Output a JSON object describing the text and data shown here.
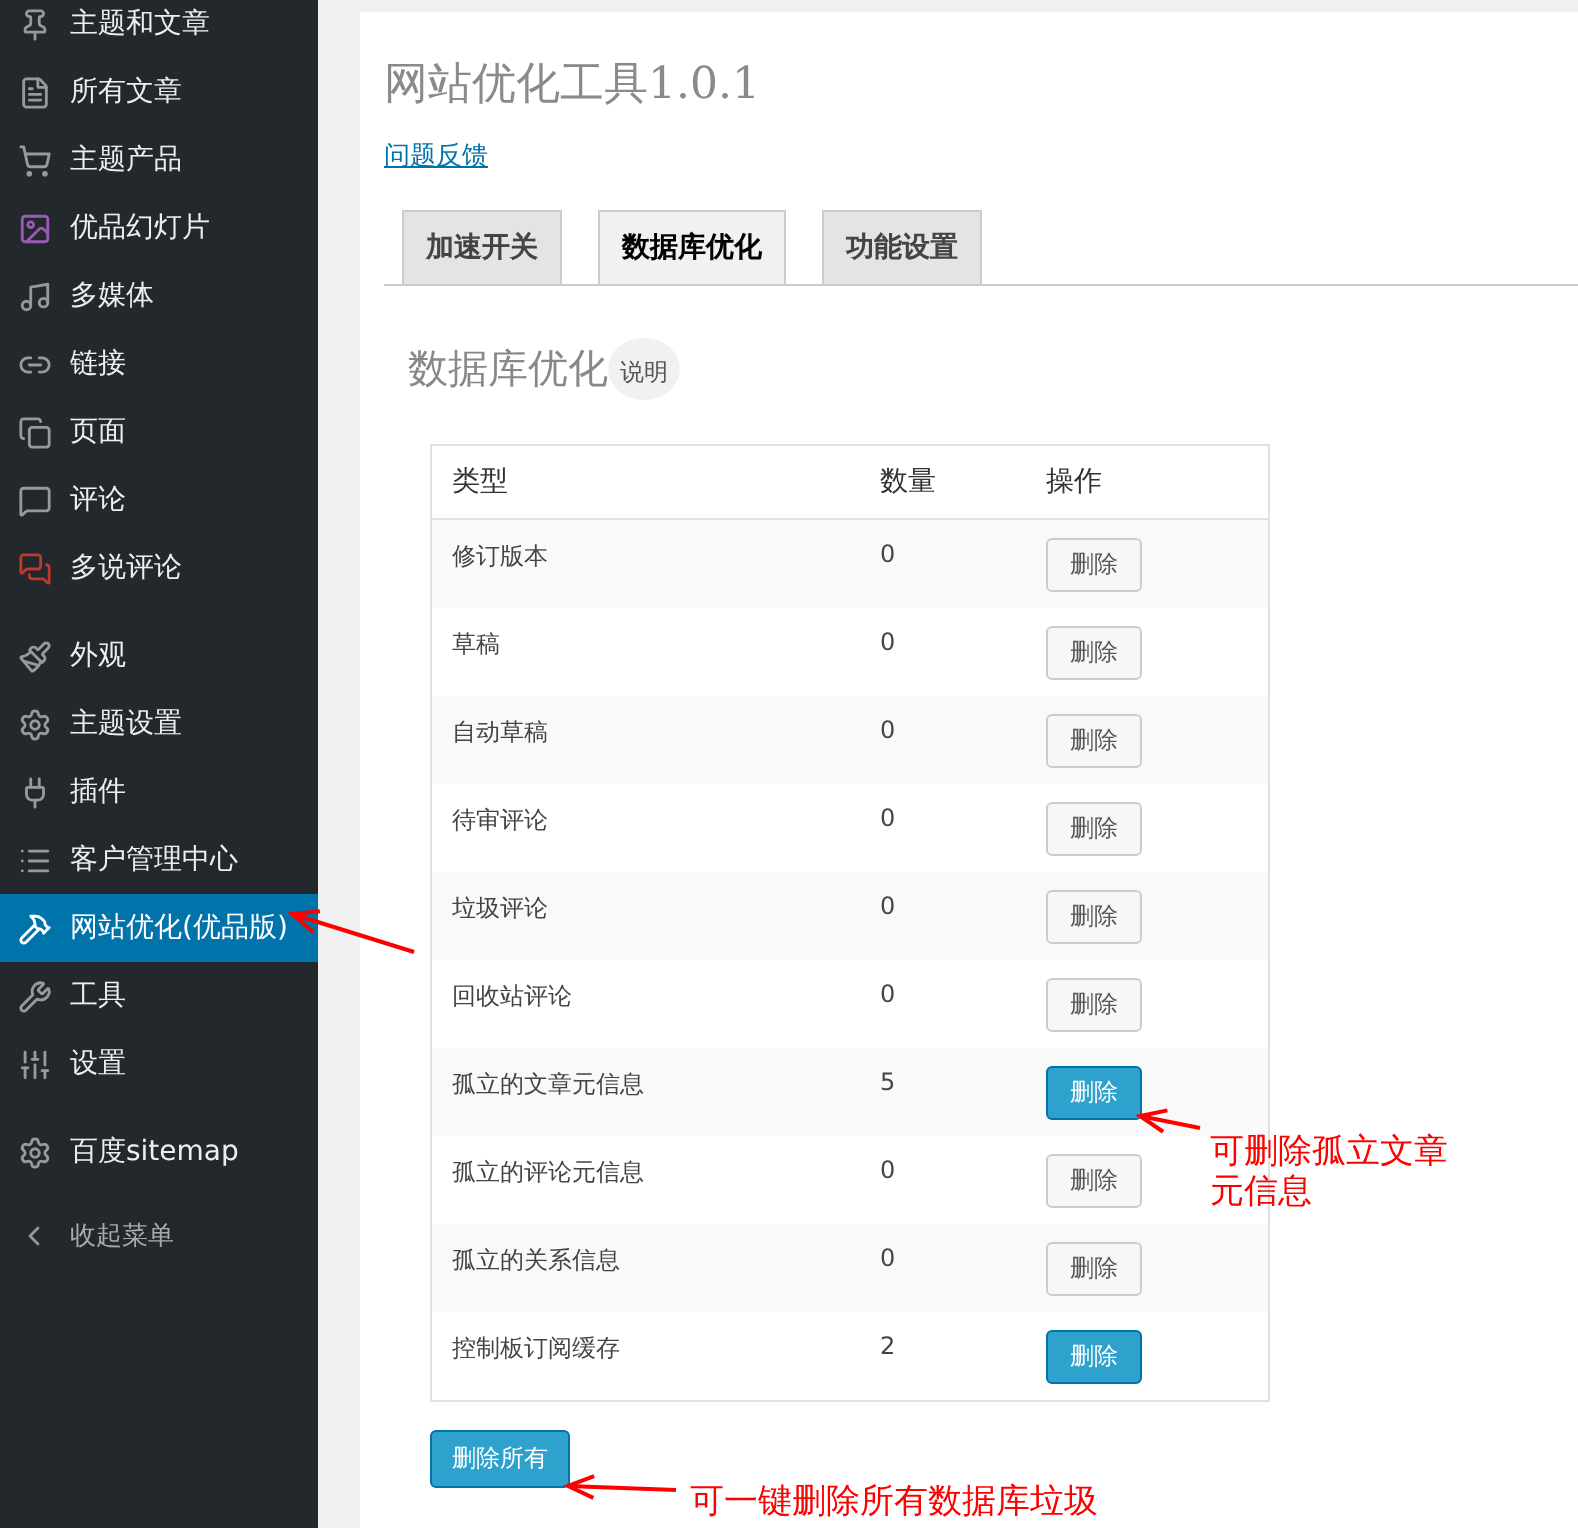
{
  "sidebar": {
    "groups": [
      {
        "items": [
          {
            "label": "主题和文章",
            "selected": false
          },
          {
            "label": "所有文章",
            "selected": false
          },
          {
            "label": "主题产品",
            "selected": false
          },
          {
            "label": "优品幻灯片",
            "selected": false
          },
          {
            "label": "多媒体",
            "selected": false
          },
          {
            "label": "链接",
            "selected": false
          },
          {
            "label": "页面",
            "selected": false
          },
          {
            "label": "评论",
            "selected": false
          },
          {
            "label": "多说评论",
            "selected": false
          }
        ]
      },
      {
        "items": [
          {
            "label": "外观",
            "selected": false
          },
          {
            "label": "主题设置",
            "selected": false
          },
          {
            "label": "插件",
            "selected": false
          },
          {
            "label": "客户管理中心",
            "selected": false
          },
          {
            "label": "网站优化(优品版)",
            "selected": true
          },
          {
            "label": "工具",
            "selected": false
          },
          {
            "label": "设置",
            "selected": false
          }
        ]
      },
      {
        "items": [
          {
            "label": "百度sitemap",
            "selected": false
          }
        ]
      }
    ],
    "collapse": "收起菜单"
  },
  "page": {
    "title": "网站优化工具1.0.1",
    "feedback_link": "问题反馈"
  },
  "tabs": [
    {
      "label": "加速开关",
      "selected": false
    },
    {
      "label": "数据库优化",
      "selected": true
    },
    {
      "label": "功能设置",
      "selected": false
    }
  ],
  "section": {
    "heading": "数据库优化",
    "help": "说明"
  },
  "table": {
    "columns": [
      "类型",
      "数量",
      "操作"
    ],
    "rows": [
      {
        "type": "修订版本",
        "count": "0",
        "action": "删除",
        "highlighted": false
      },
      {
        "type": "草稿",
        "count": "0",
        "action": "删除",
        "highlighted": false
      },
      {
        "type": "自动草稿",
        "count": "0",
        "action": "删除",
        "highlighted": false
      },
      {
        "type": "待审评论",
        "count": "0",
        "action": "删除",
        "highlighted": false
      },
      {
        "type": "垃圾评论",
        "count": "0",
        "action": "删除",
        "highlighted": false
      },
      {
        "type": "回收站评论",
        "count": "0",
        "action": "删除",
        "highlighted": false
      },
      {
        "type": "孤立的文章元信息",
        "count": "5",
        "action": "删除",
        "highlighted": true
      },
      {
        "type": "孤立的评论元信息",
        "count": "0",
        "action": "删除",
        "highlighted": false
      },
      {
        "type": "孤立的关系信息",
        "count": "0",
        "action": "删除",
        "highlighted": false
      },
      {
        "type": "控制板订阅缓存",
        "count": "2",
        "action": "删除",
        "highlighted": true
      }
    ]
  },
  "delete_all": "删除所有",
  "annotations": [
    {
      "text": "可删除孤立文章元信息"
    },
    {
      "text": "可一键删除所有数据库垃圾"
    }
  ]
}
